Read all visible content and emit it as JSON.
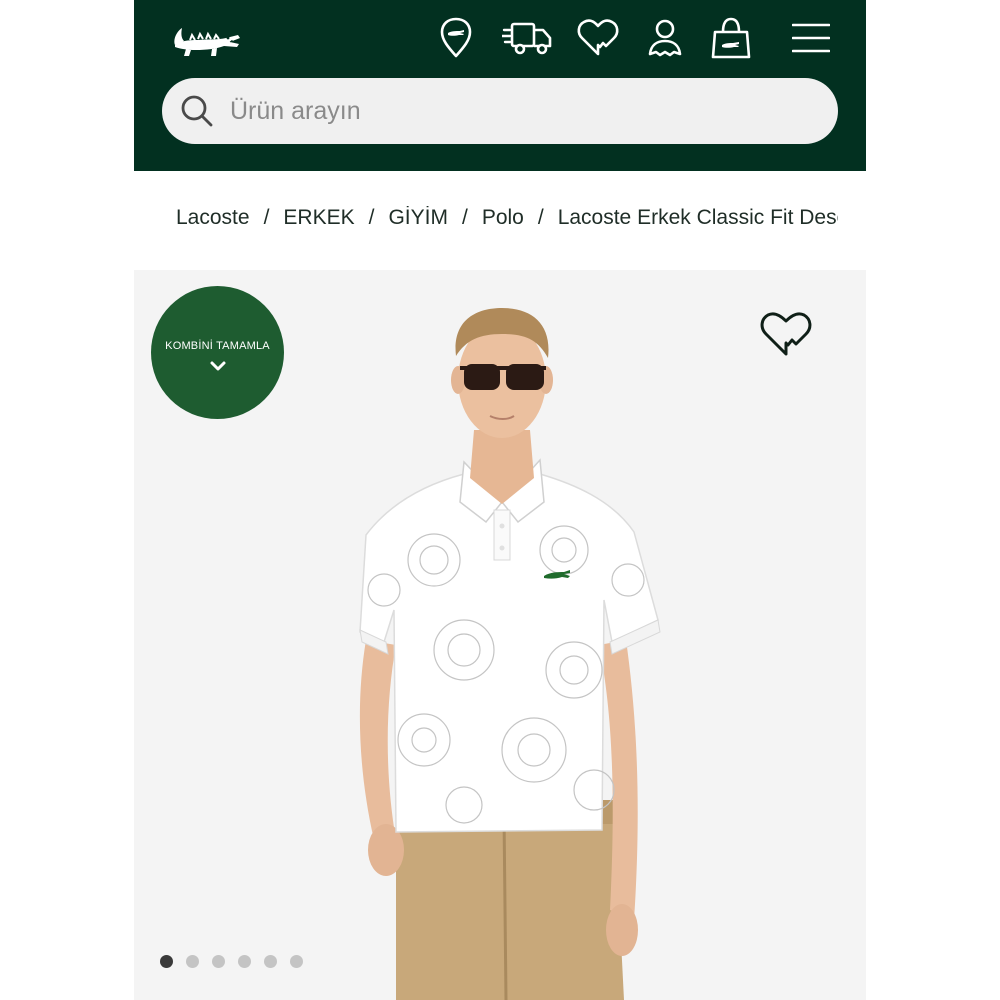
{
  "header": {
    "logo_icon": "crocodile-logo",
    "icons": [
      "store-locator-icon",
      "delivery-truck-icon",
      "wishlist-heart-icon",
      "account-icon",
      "shopping-bag-icon",
      "hamburger-menu-icon"
    ],
    "search": {
      "placeholder": "Ürün arayın",
      "icon": "search-icon"
    }
  },
  "breadcrumb": {
    "items": [
      "Lacoste",
      "ERKEK",
      "GİYİM",
      "Polo",
      "Lacoste Erkek Classic Fit Desenli Polo"
    ]
  },
  "product": {
    "kombin_label": "KOMBİNİ TAMAMLA",
    "kombin_icon": "chevron-down-icon",
    "wishlist_icon": "heart-outline-icon",
    "image_description": "model-white-printed-polo",
    "carousel": {
      "total": 6,
      "active": 1
    }
  },
  "colors": {
    "header_bg": "#023020",
    "badge_bg": "#1e5c30",
    "panel_bg": "#f4f4f4"
  }
}
